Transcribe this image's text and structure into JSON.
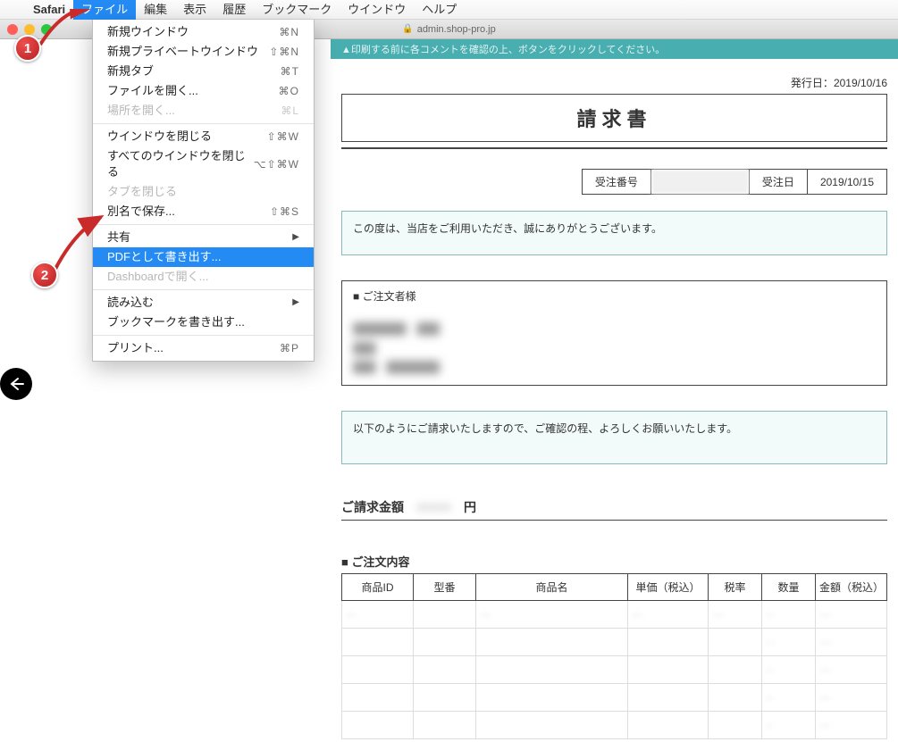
{
  "menubar": {
    "app": "Safari",
    "items": [
      "ファイル",
      "編集",
      "表示",
      "履歴",
      "ブックマーク",
      "ウインドウ",
      "ヘルプ"
    ]
  },
  "titlebar": {
    "traffic": {
      "close": "#ff5f57",
      "min": "#ffbd2e",
      "max": "#28c940"
    },
    "host": "admin.shop-pro.jp"
  },
  "banner": "▲印刷する前に各コメントを確認の上、ボタンをクリックしてください。",
  "menu": {
    "g1": [
      {
        "label": "新規ウインドウ",
        "sc": "⌘N",
        "dis": false
      },
      {
        "label": "新規プライベートウインドウ",
        "sc": "⇧⌘N",
        "dis": false
      },
      {
        "label": "新規タブ",
        "sc": "⌘T",
        "dis": false
      },
      {
        "label": "ファイルを開く...",
        "sc": "⌘O",
        "dis": false
      },
      {
        "label": "場所を開く...",
        "sc": "⌘L",
        "dis": true
      }
    ],
    "g2": [
      {
        "label": "ウインドウを閉じる",
        "sc": "⇧⌘W",
        "dis": false
      },
      {
        "label": "すべてのウインドウを閉じる",
        "sc": "⌥⇧⌘W",
        "dis": false
      },
      {
        "label": "タブを閉じる",
        "sc": "",
        "dis": true
      },
      {
        "label": "別名で保存...",
        "sc": "⇧⌘S",
        "dis": false
      }
    ],
    "g3": [
      {
        "label": "共有",
        "sub": true,
        "dis": false
      },
      {
        "label": "PDFとして書き出す...",
        "hi": true,
        "dis": false
      },
      {
        "label": "Dashboardで開く...",
        "dis": true
      }
    ],
    "g4": [
      {
        "label": "読み込む",
        "sub": true,
        "dis": false
      },
      {
        "label": "ブックマークを書き出す...",
        "dis": false
      }
    ],
    "g5": [
      {
        "label": "プリント...",
        "sc": "⌘P",
        "dis": false
      }
    ]
  },
  "doc": {
    "issue_label": "発行日：",
    "issue_date": "2019/10/16",
    "title": "請求書",
    "order": {
      "no_label": "受注番号",
      "date_label": "受注日",
      "date": "2019/10/15"
    },
    "thanks": "この度は、当店をご利用いただき、誠にありがとうございます。",
    "orderer_label": "■ ご注文者様",
    "req_text": "以下のようにご請求いたしますので、ご確認の程、よろしくお願いいたします。",
    "amount_label": "ご請求金額",
    "amount_unit": "円",
    "content_label": "■ ご注文内容",
    "cols": [
      "商品ID",
      "型番",
      "商品名",
      "単価（税込）",
      "税率",
      "数量",
      "金額（税込）"
    ]
  },
  "annot": {
    "b1": "1",
    "b2": "2"
  }
}
